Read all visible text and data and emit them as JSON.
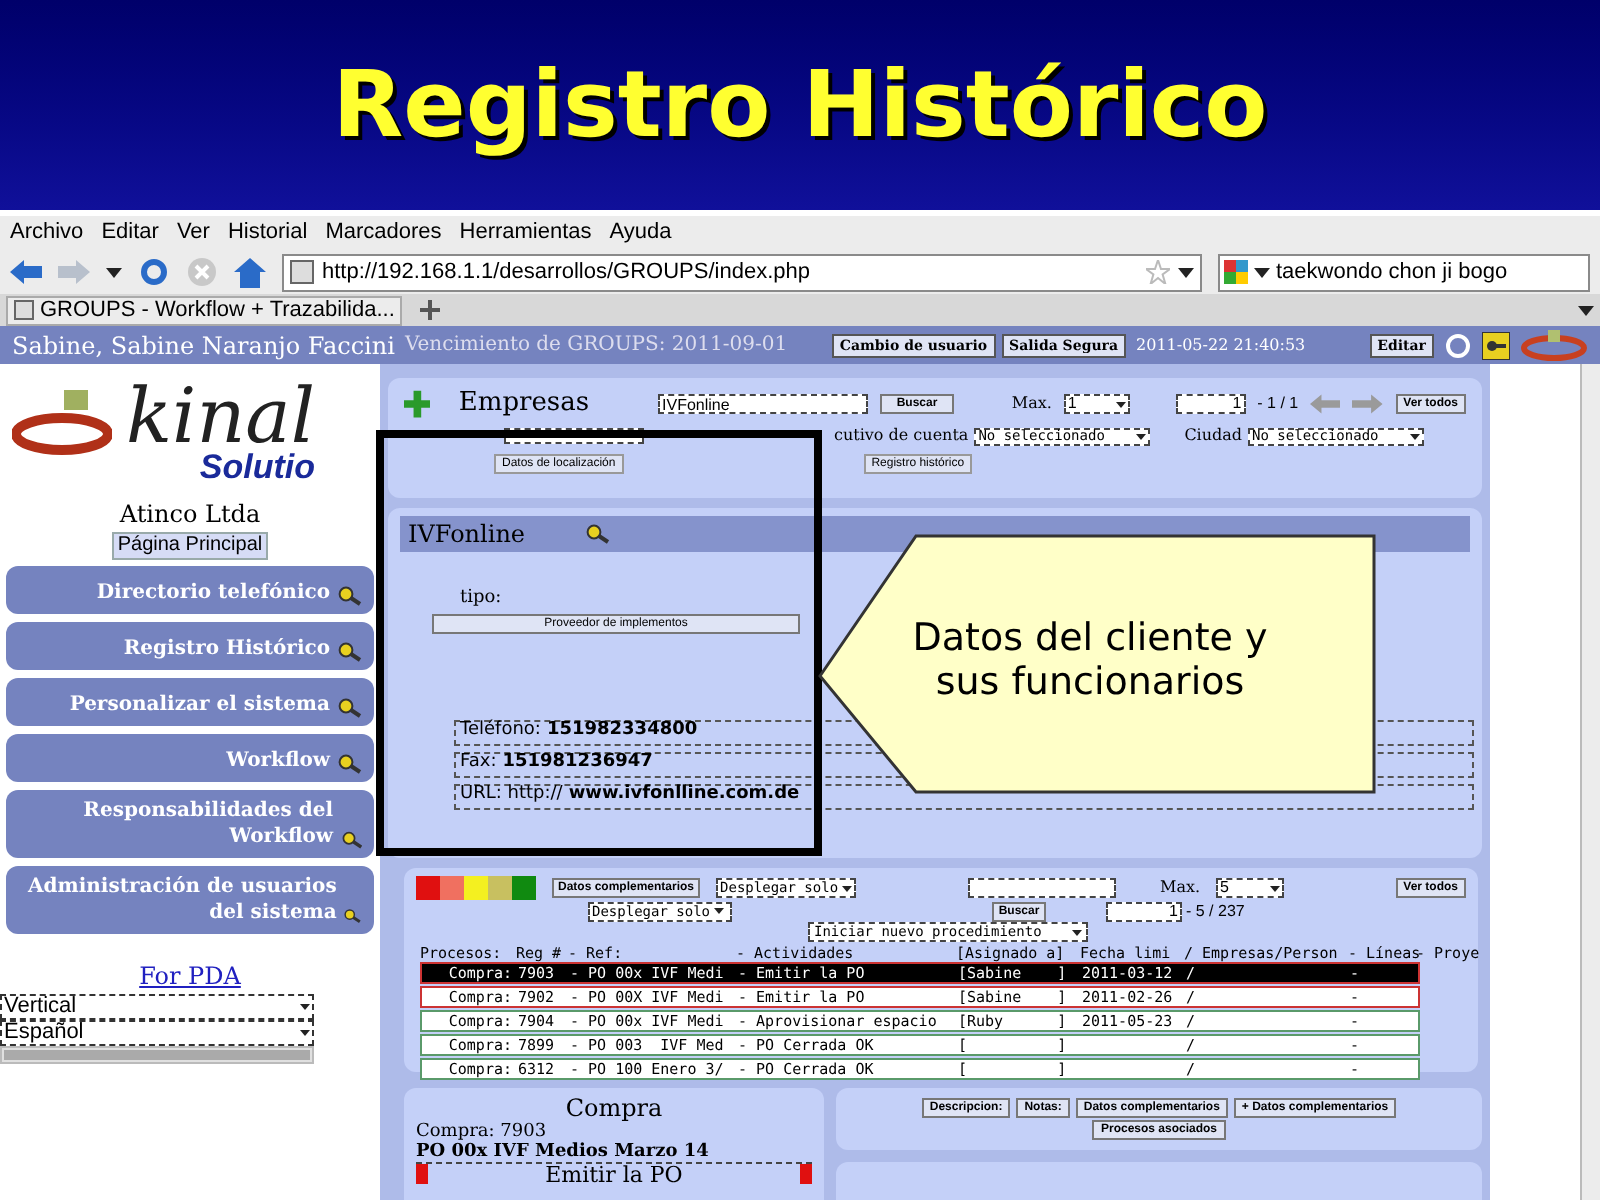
{
  "slide": {
    "title": "Registro Histórico",
    "callout": "Datos del cliente y sus funcionarios"
  },
  "browser": {
    "menu": [
      "Archivo",
      "Editar",
      "Ver",
      "Historial",
      "Marcadores",
      "Herramientas",
      "Ayuda"
    ],
    "url": "http://192.168.1.1/desarrollos/GROUPS/index.php",
    "search": "taekwondo chon ji bogo",
    "tab": "GROUPS - Workflow + Trazabilida..."
  },
  "header": {
    "user": "Sabine, Sabine Naranjo Faccini",
    "expiry": "Vencimiento de GROUPS: 2011-09-01",
    "buttons": [
      "Cambio de usuario",
      "Salida Segura"
    ],
    "timestamp": "2011-05-22 21:40:53",
    "edit_button": "Editar"
  },
  "sidebar": {
    "logo": {
      "text": "kinal",
      "subtext": "Solutio"
    },
    "company": "Atinco Ltda",
    "home_button": "Página Principal",
    "items": [
      "Directorio telefónico",
      "Registro Histórico",
      "Personalizar el sistema",
      "Workflow",
      "Responsabilidades del Workflow",
      "Administración de usuarios del sistema"
    ],
    "pda_link": "For PDA",
    "selects": [
      "Vertical",
      "Español"
    ]
  },
  "empresas": {
    "title": "Empresas",
    "search_value": "IVFonline",
    "search_button": "Buscar",
    "max_label": "Max.",
    "max_value": "1",
    "page_value": "1",
    "page_range": "- 1 / 1",
    "show_all": "Ver todos",
    "filters": [
      {
        "label": "cutivo de cuenta",
        "value": "No seleccionado"
      },
      {
        "label": "Ciudad",
        "value": "No seleccionado"
      }
    ],
    "buttons": [
      "Datos de localización",
      "Registro histórico"
    ]
  },
  "company": {
    "name": "IVFonline",
    "type_label": "tipo:",
    "type_button": "Proveedor de implementos",
    "fields": [
      {
        "label": "Teléfono:",
        "value": "151982334800"
      },
      {
        "label": "Fax:",
        "value": "151981236947"
      },
      {
        "label": "URL: http://",
        "value": "www.ivfonlline.com.de"
      }
    ]
  },
  "processes": {
    "legend": [
      {
        "color": "#e01010"
      },
      {
        "color": "#f07060"
      },
      {
        "color": "#f4f020"
      },
      {
        "color": "#c8c060"
      },
      {
        "color": "#108a10"
      }
    ],
    "details_button": "Datos complementarios",
    "filter_1": "Desplegar solo",
    "filter_2": "Desplegar solo",
    "search_button": "Buscar",
    "max_label": "Max.",
    "max_value": "5",
    "show_all": "Ver todos",
    "page_value": "1",
    "page_range": "- 5 / 237",
    "new_procedure": "Iniciar nuevo procedimiento",
    "columns": [
      "Procesos:",
      "Reg #",
      "- Ref:",
      "- Actividades",
      "[Asignado a]",
      "Fecha limi",
      "/ Empresas/Person",
      "- Líneas",
      "- Proye"
    ],
    "rows": [
      {
        "selected": true,
        "color": "#cc3333",
        "process": "Compra:",
        "reg": "7903",
        "ref": "- PO 00x IVF Medi",
        "activity": "- Emitir la PO",
        "assigned": "[Sabine    ]",
        "deadline": "2011-03-12",
        "company": "/",
        "lines": "-"
      },
      {
        "selected": false,
        "color": "#cc3333",
        "process": "Compra:",
        "reg": "7902",
        "ref": "- PO 00X IVF Medi",
        "activity": "- Emitir la PO",
        "assigned": "[Sabine    ]",
        "deadline": "2011-02-26",
        "company": "/",
        "lines": "-"
      },
      {
        "selected": false,
        "color": "#5a9a6a",
        "process": "Compra:",
        "reg": "7904",
        "ref": "- PO 00x IVF Medi",
        "activity": "- Aprovisionar espacio",
        "assigned": "[Ruby      ]",
        "deadline": "2011-05-23",
        "company": "/",
        "lines": "-"
      },
      {
        "selected": false,
        "color": "#5a9a6a",
        "process": "Compra:",
        "reg": "7899",
        "ref": "- PO 003  IVF Med",
        "activity": "- PO Cerrada OK",
        "assigned": "[          ]",
        "company": "/",
        "lines": "-"
      },
      {
        "selected": false,
        "color": "#5a9a6a",
        "process": "Compra:",
        "reg": "6312",
        "ref": "- PO 100 Enero 3/",
        "activity": "- PO Cerrada OK",
        "assigned": "[          ]",
        "company": "/",
        "lines": "-"
      }
    ]
  },
  "detail": {
    "title": "Compra",
    "record": "Compra: 7903",
    "reference": "PO 00x IVF Medios Marzo 14",
    "activity": "Emitir la PO",
    "tabs": [
      "Descripcion:",
      "Notas:",
      "Datos complementarios",
      "+ Datos complementarios",
      "Procesos asociados"
    ]
  }
}
